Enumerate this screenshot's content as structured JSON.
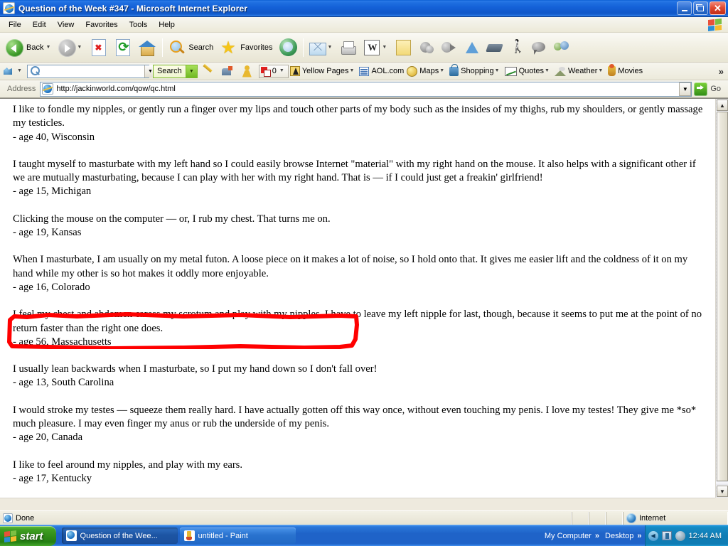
{
  "window": {
    "title": "Question of the Week #347 - Microsoft Internet Explorer",
    "icon": "ie-document-icon",
    "minimize_label": "Minimize",
    "restore_label": "Restore",
    "close_label": "Close"
  },
  "menubar": {
    "items": [
      {
        "label": "File"
      },
      {
        "label": "Edit"
      },
      {
        "label": "View"
      },
      {
        "label": "Favorites"
      },
      {
        "label": "Tools"
      },
      {
        "label": "Help"
      }
    ]
  },
  "toolbar": {
    "back_label": "Back",
    "search_label": "Search",
    "favorites_label": "Favorites",
    "icons": [
      "back-icon",
      "forward-icon",
      "stop-icon",
      "refresh-icon",
      "home-icon",
      "search-icon",
      "favorites-star-icon",
      "media-icon",
      "mail-icon",
      "print-icon",
      "edit-with-word-icon",
      "notes-icon",
      "messenger-icon",
      "media-play-icon",
      "research-icon",
      "encyclopedia-icon",
      "walk-icon",
      "discuss-icon",
      "people-icon"
    ]
  },
  "toolbar2": {
    "search_placeholder": "",
    "search_value": "",
    "search_button_label": "Search",
    "counter_value": "0",
    "items": [
      {
        "label": "Yellow Pages",
        "icon": "yellow-pages-icon",
        "has_menu": true
      },
      {
        "label": "AOL.com",
        "icon": "aol-icon",
        "has_menu": false
      },
      {
        "label": "Maps",
        "icon": "maps-icon",
        "has_menu": true
      },
      {
        "label": "Shopping",
        "icon": "shopping-bag-icon",
        "has_menu": true
      },
      {
        "label": "Quotes",
        "icon": "stock-quotes-icon",
        "has_menu": true
      },
      {
        "label": "Weather",
        "icon": "weather-icon",
        "has_menu": true
      },
      {
        "label": "Movies",
        "icon": "movies-icon",
        "has_menu": false
      }
    ],
    "overflow_label": "»"
  },
  "addressbar": {
    "label": "Address",
    "url": "http://jackinworld.com/qow/qc.html",
    "go_label": "Go"
  },
  "page": {
    "paragraphs": [
      {
        "text": "I like to fondle my nipples, or gently run a finger over my lips and touch other parts of my body such as the insides of my thighs, rub my shoulders, or gently massage my testicles.",
        "signature": "- age 40, Wisconsin"
      },
      {
        "text": "I taught myself to masturbate with my left hand so I could easily browse Internet \"material\" with my right hand on the mouse. It also helps with a significant other if we are mutually masturbating, because I can play with her with my right hand. That is — if I could just get a freakin' girlfriend!",
        "signature": "- age 15, Michigan"
      },
      {
        "text": "Clicking the mouse on the computer — or, I rub my chest. That turns me on.",
        "signature": "- age 19, Kansas",
        "annotated": true
      },
      {
        "text": "When I masturbate, I am usually on my metal futon. A loose piece on it makes a lot of noise, so I hold onto that. It gives me easier lift and the coldness of it on my hand while my other is so hot makes it oddly more enjoyable.",
        "signature": "- age 16, Colorado"
      },
      {
        "text": "I feel my chest and abdomen caress my scrotum and play with my nipples. I have to leave my left nipple for last, though, because it seems to put me at the point of no return faster than the right one does.",
        "signature": "- age 56, Massachusetts"
      },
      {
        "text": "I usually lean backwards when I masturbate, so I put my hand down so I don't fall over!",
        "signature": "- age 13, South Carolina"
      },
      {
        "text": "I would stroke my testes — squeeze them really hard. I have actually gotten off this way once, without even touching my penis. I love my testes! They give me *so* much pleasure. I may even finger my anus or rub the underside of my penis.",
        "signature": "- age 20, Canada"
      },
      {
        "text": "I like to feel around my nipples, and play with my ears.",
        "signature": "- age 17, Kentucky"
      }
    ],
    "annotation": {
      "type": "hand-drawn-rectangle",
      "color": "#FF0000",
      "tool": "paint-freehand"
    }
  },
  "statusbar": {
    "status_text": "Done",
    "zone_text": "Internet"
  },
  "taskbar": {
    "start_label": "start",
    "tasks": [
      {
        "label": "Question of the Wee...",
        "icon": "ie-icon",
        "active": true
      },
      {
        "label": "untitled - Paint",
        "icon": "paint-icon",
        "active": false
      }
    ],
    "toolbars": [
      {
        "label": "My Computer"
      },
      {
        "label": "Desktop"
      }
    ],
    "overflow_glyph": "»",
    "clock": "12:44 AM"
  },
  "colors": {
    "titlebar_blue": "#1461d8",
    "annotation_red": "#FF0000",
    "taskbar_blue": "#1f63c8",
    "start_green": "#2f8a18",
    "page_bg": "#FFFFFF"
  }
}
